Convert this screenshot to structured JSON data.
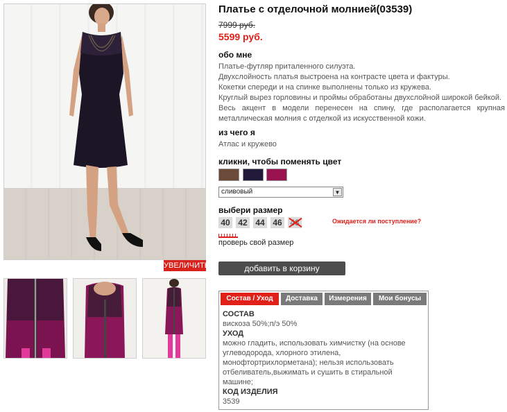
{
  "product": {
    "title": "Платье с отделочной молнией(03539)",
    "old_price": "7999 руб.",
    "new_price": "5599 руб."
  },
  "gallery": {
    "zoom_label": "УВЕЛИЧИТЬ"
  },
  "about": {
    "heading": "обо мне",
    "lines": [
      "Платье-футляр приталенного силуэта.",
      "Двухслойность платья выстроена на контрасте цвета и фактуры.",
      "Кокетки спереди и на спинке выполнены только из кружева.",
      "Круглый вырез горловины и проймы обработаны двухслойной широкой бейкой.",
      "Весь акцент в модели перенесен на спину, где располагается крупная металлическая молния с отделкой из искусственной кожи."
    ]
  },
  "material": {
    "heading": "из чего я",
    "value": "Атлас и кружево"
  },
  "color": {
    "heading": "кликни, чтобы поменять цвет",
    "swatches": [
      "#6b4a3a",
      "#221a3a",
      "#9a1350"
    ],
    "selected": "сливовый"
  },
  "sizes": {
    "heading": "выбери размер",
    "items": [
      "40",
      "42",
      "44",
      "46",
      "48"
    ],
    "await_link": "Ожидается ли поступление?",
    "check_size": "проверь свой размер"
  },
  "cart": {
    "button": "добавить в корзину"
  },
  "tabs": {
    "labels": [
      "Состав / Уход",
      "Доставка",
      "Измерения",
      "Мои бонусы"
    ],
    "content": {
      "composition_heading": "СОСТАВ",
      "composition": "вискоза 50%;п/э 50%",
      "care_heading": "УХОД",
      "care": "можно гладить, использовать химчистку (на основе углеводорода, хлорного этилена, монофтортрихлорметана); нельзя использовать отбеливатель,выжимать и сушить в стиральной машине;",
      "code_heading": "КОД ИЗДЕЛИЯ",
      "code": "3539"
    }
  },
  "colors": {
    "accent": "#e2201a",
    "button_dark": "#4d4d4d",
    "tab_inactive": "#7a7a7a"
  }
}
